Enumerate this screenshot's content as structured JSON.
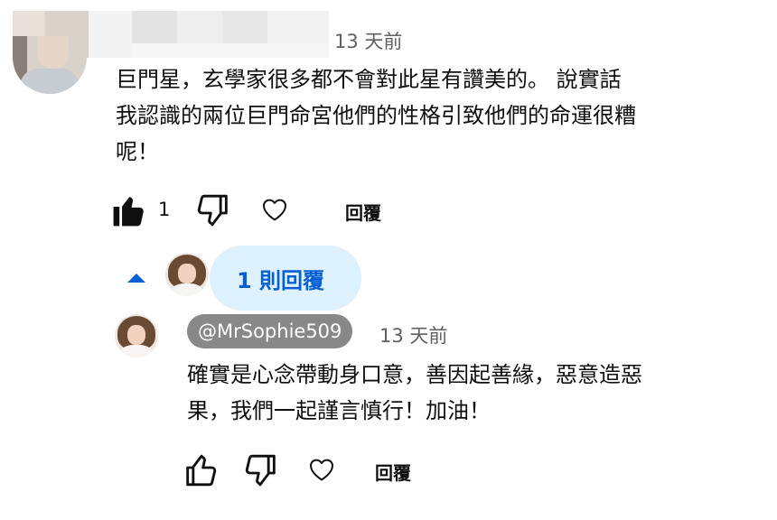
{
  "comment": {
    "timestamp": "13 天前",
    "text_lines": [
      "巨門星，玄學家很多都不會對此星有讚美的。 說實話",
      "我認識的兩位巨門命宮他們的性格引致他們的命運很糟",
      "呢！"
    ],
    "like_count": "1",
    "reply_label": "回覆"
  },
  "replies_toggle": {
    "label": "1 則回覆",
    "color": "#065fd4",
    "background": "#def1ff"
  },
  "reply": {
    "author_handle": "@MrSophie509",
    "timestamp": "13 天前",
    "text_lines": [
      "確實是心念帶動身口意，善因起善緣，惡意造惡",
      "果，我們一起謹言慎行！加油！"
    ],
    "reply_label": "回覆"
  },
  "icons": {
    "like_filled": "thumbs-up-filled-icon",
    "dislike": "thumbs-down-icon",
    "heart": "heart-icon",
    "expand": "caret-up-icon",
    "like_outline": "thumbs-up-icon"
  }
}
